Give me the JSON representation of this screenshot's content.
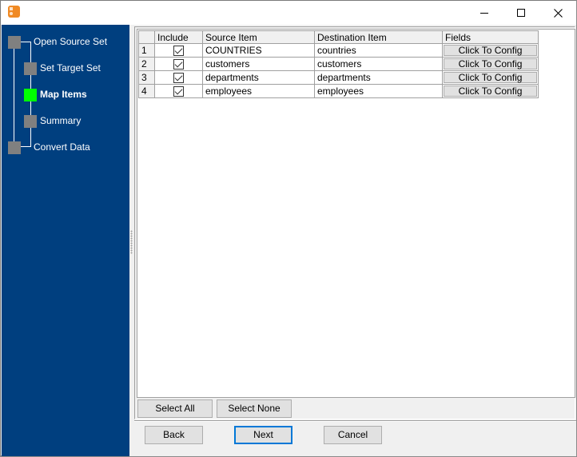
{
  "window": {
    "title": "",
    "controls": {
      "minimize": "minimize",
      "maximize": "maximize",
      "close": "close"
    }
  },
  "colors": {
    "sidebar_bg": "#003f7f",
    "step_inactive": "#808080",
    "step_active": "#00ff00",
    "default_button_border": "#0078d7"
  },
  "wizard": {
    "steps": [
      {
        "label": "Open Source Set",
        "state": "done",
        "level": 0
      },
      {
        "label": "Set Target Set",
        "state": "done",
        "level": 1
      },
      {
        "label": "Map Items",
        "state": "active",
        "level": 1
      },
      {
        "label": "Summary",
        "state": "pending",
        "level": 1
      },
      {
        "label": "Convert Data",
        "state": "pending",
        "level": 0
      }
    ]
  },
  "grid": {
    "columns": [
      "",
      "Include",
      "Source Item",
      "Destination Item",
      "Fields"
    ],
    "rows": [
      {
        "num": "1",
        "include": true,
        "source": "COUNTRIES",
        "destination": "countries",
        "fields": "Click To Config"
      },
      {
        "num": "2",
        "include": true,
        "source": "customers",
        "destination": "customers",
        "fields": "Click To Config"
      },
      {
        "num": "3",
        "include": true,
        "source": "departments",
        "destination": "departments",
        "fields": "Click To Config"
      },
      {
        "num": "4",
        "include": true,
        "source": "employees",
        "destination": "employees",
        "fields": "Click To Config"
      }
    ]
  },
  "buttons": {
    "select_all": "Select All",
    "select_none": "Select None",
    "back": "Back",
    "next": "Next",
    "cancel": "Cancel"
  }
}
